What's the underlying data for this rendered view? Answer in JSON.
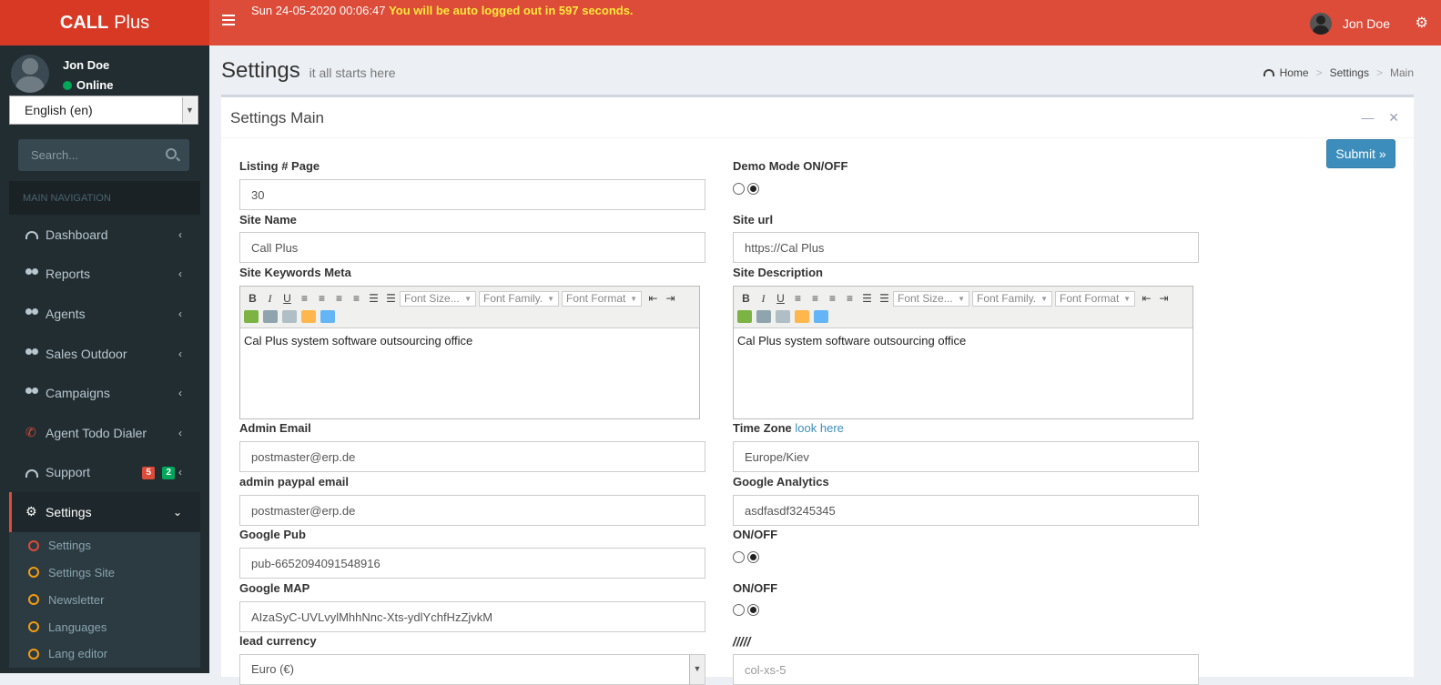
{
  "brand": {
    "bold": "CALL",
    "rest": "Plus"
  },
  "topbar": {
    "datetime": "Sun 24-05-2020 00:06:47",
    "logout_warning": "You will be auto logged out in 597 seconds.",
    "user_name": "Jon Doe"
  },
  "sidebar": {
    "user_name": "Jon Doe",
    "status": "Online",
    "language": "English (en)",
    "search_placeholder": "Search...",
    "nav_header": "MAIN NAVIGATION",
    "items": [
      {
        "label": "Dashboard",
        "icon": "dashboard-icon"
      },
      {
        "label": "Reports",
        "icon": "users-icon"
      },
      {
        "label": "Agents",
        "icon": "users-icon"
      },
      {
        "label": "Sales Outdoor",
        "icon": "users-icon"
      },
      {
        "label": "Campaigns",
        "icon": "users-icon"
      },
      {
        "label": "Agent Todo Dialer",
        "icon": "phone-icon"
      },
      {
        "label": "Support",
        "icon": "dashboard-icon",
        "badges": [
          "5",
          "2"
        ]
      },
      {
        "label": "Settings",
        "icon": "cogs-icon",
        "active": true
      }
    ],
    "submenu": [
      {
        "label": "Settings",
        "color": "#dd4b39"
      },
      {
        "label": "Settings Site",
        "color": "#f39c12"
      },
      {
        "label": "Newsletter",
        "color": "#f39c12"
      },
      {
        "label": "Languages",
        "color": "#f39c12"
      },
      {
        "label": "Lang editor",
        "color": "#f39c12"
      }
    ]
  },
  "header": {
    "title": "Settings",
    "subtitle": "it all starts here",
    "breadcrumb": [
      "Home",
      "Settings",
      "Main"
    ]
  },
  "box": {
    "title": "Settings Main",
    "submit": "Submit »"
  },
  "form": {
    "listing_label": "Listing # Page",
    "listing_value": "30",
    "demo_label": "Demo Mode ON/OFF",
    "site_name_label": "Site Name",
    "site_name_value": "Call Plus",
    "site_url_label": "Site url",
    "site_url_value": "https://Cal Plus",
    "keywords_label": "Site Keywords Meta",
    "keywords_value": "Cal Plus system software outsourcing office",
    "description_label": "Site Description",
    "description_value": "Cal Plus system software outsourcing office",
    "admin_email_label": "Admin Email",
    "admin_email_value": "postmaster@erp.de",
    "timezone_label": "Time Zone",
    "timezone_link": "look here",
    "timezone_value": "Europe/Kiev",
    "paypal_label": "admin paypal email",
    "paypal_value": "postmaster@erp.de",
    "analytics_label": "Google Analytics",
    "analytics_value": "asdfasdf3245345",
    "pub_label": "Google Pub",
    "pub_value": "pub-6652094091548916",
    "onoff1_label": "ON/OFF",
    "map_label": "Google MAP",
    "map_value": "AIzaSyC-UVLvylMhhNnc-Xts-ydlYchfHzZjvkM",
    "onoff2_label": "ON/OFF",
    "currency_label": "lead currency",
    "currency_value": "Euro (€)",
    "slashes_label": "/////",
    "slashes_placeholder": "col-xs-5"
  },
  "editor_toolbar": {
    "font_size": "Font Size...",
    "font_family": "Font Family.",
    "font_format": "Font Format"
  }
}
